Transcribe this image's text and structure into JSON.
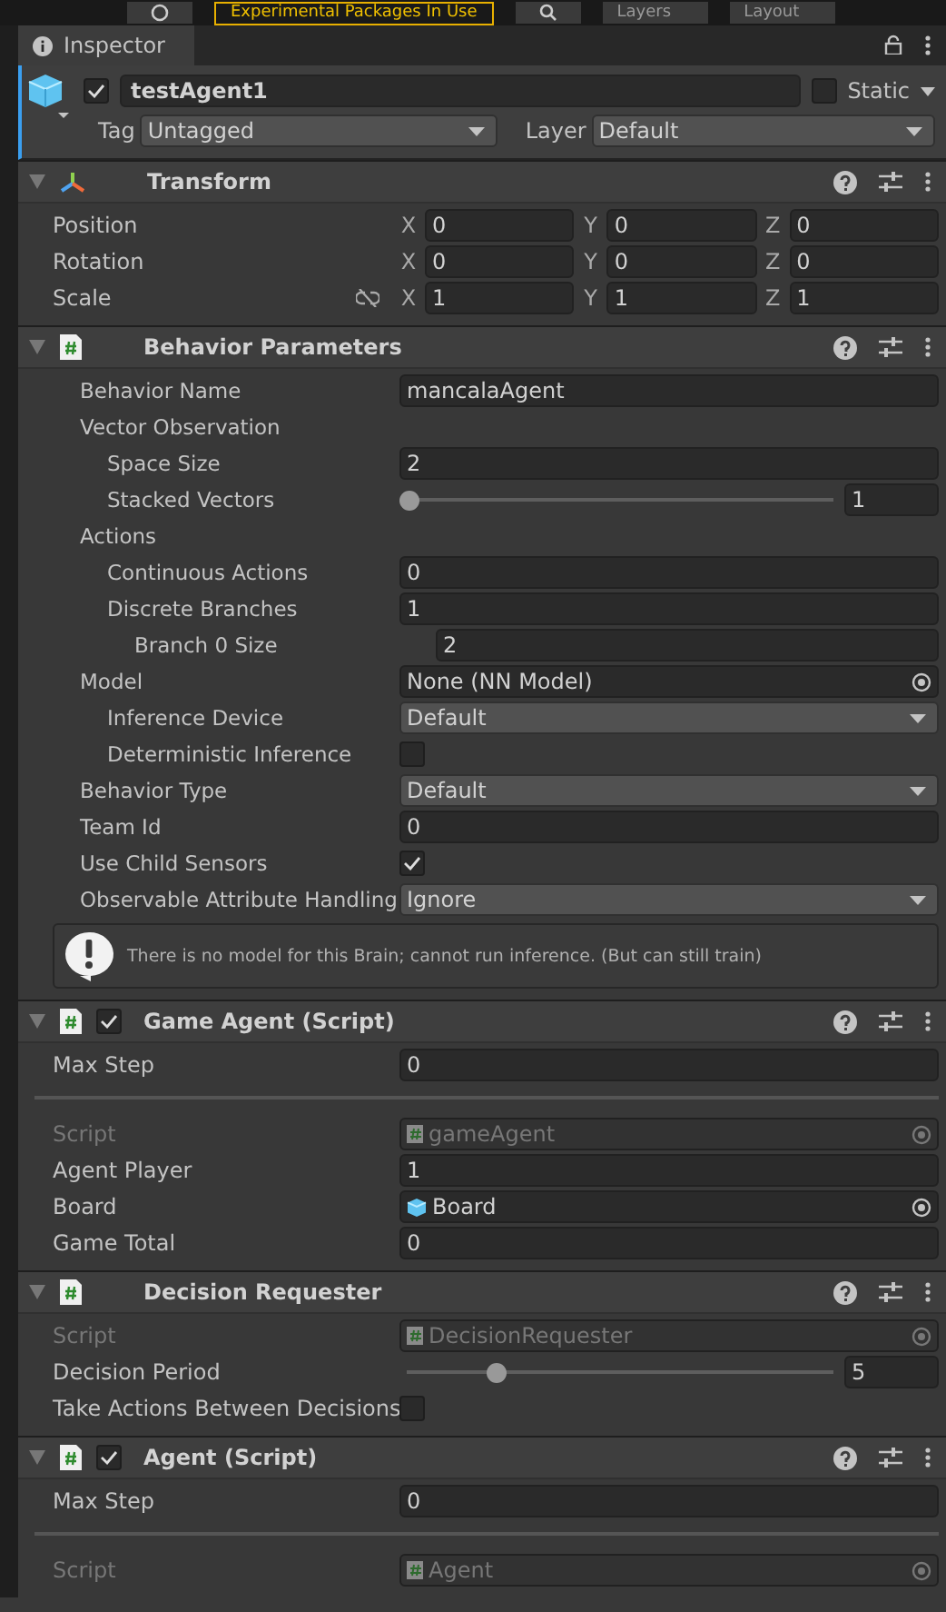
{
  "toolbar": {
    "packages_label": "Experimental Packages In Use",
    "layers_label": "Layers",
    "layout_label": "Layout"
  },
  "tab": {
    "title": "Inspector",
    "selected": true
  },
  "game_object": {
    "active": true,
    "name": "testAgent1",
    "static": false,
    "static_label": "Static",
    "tag_label": "Tag",
    "tag": "Untagged",
    "layer_label": "Layer",
    "layer": "Default"
  },
  "components": [
    {
      "title": "Transform",
      "kind": "transform",
      "expanded": true,
      "rows": [
        {
          "kind": "vector",
          "label": "Position",
          "link_icon": false,
          "axes": [
            {
              "axis": "X",
              "value": "0"
            },
            {
              "axis": "Y",
              "value": "0"
            },
            {
              "axis": "Z",
              "value": "0"
            }
          ]
        },
        {
          "kind": "vector",
          "label": "Rotation",
          "link_icon": false,
          "axes": [
            {
              "axis": "X",
              "value": "0"
            },
            {
              "axis": "Y",
              "value": "0"
            },
            {
              "axis": "Z",
              "value": "0"
            }
          ]
        },
        {
          "kind": "vector",
          "label": "Scale",
          "link_icon": true,
          "axes": [
            {
              "axis": "X",
              "value": "1"
            },
            {
              "axis": "Y",
              "value": "1"
            },
            {
              "axis": "Z",
              "value": "1"
            }
          ]
        }
      ]
    },
    {
      "title": "Behavior Parameters",
      "kind": "script",
      "expanded": true,
      "rows": [
        {
          "kind": "field",
          "label": "Behavior Name",
          "value": "mancalaAgent"
        },
        {
          "kind": "group",
          "label": "Vector Observation",
          "children": [
            {
              "kind": "field",
              "label": "Space Size",
              "value": "2"
            },
            {
              "kind": "slider",
              "label": "Stacked Vectors",
              "level": 0,
              "value": "1"
            }
          ]
        },
        {
          "kind": "group",
          "label": "Actions",
          "children": [
            {
              "kind": "field",
              "label": "Continuous Actions",
              "value": "0"
            },
            {
              "kind": "field",
              "label": "Discrete Branches",
              "value": "1",
              "children": [
                {
                  "kind": "field",
                  "label": "Branch 0 Size",
                  "value": "2"
                }
              ]
            }
          ]
        },
        {
          "kind": "object",
          "label": "Model",
          "value": "None (NN Model)",
          "disabled": false,
          "children": [
            {
              "kind": "dropdown",
              "label": "Inference Device",
              "value": "Default"
            },
            {
              "kind": "checkbox",
              "label": "Deterministic Inference",
              "checked": false
            }
          ]
        },
        {
          "kind": "dropdown",
          "label": "Behavior Type",
          "value": "Default"
        },
        {
          "kind": "field",
          "label": "Team Id",
          "value": "0"
        },
        {
          "kind": "checkbox",
          "label": "Use Child Sensors",
          "checked": true
        },
        {
          "kind": "dropdown",
          "label": "Observable Attribute Handling",
          "value": "Ignore"
        },
        {
          "kind": "helpbox",
          "text": "There is no model for this Brain; cannot run inference. (But can still train)"
        }
      ]
    },
    {
      "title": "Game Agent (Script)",
      "kind": "script",
      "enabled": true,
      "expanded": true,
      "rows": [
        {
          "kind": "field",
          "label": "Max Step",
          "value": "0"
        },
        {
          "kind": "divider"
        },
        {
          "kind": "script_object",
          "label": "Script",
          "value": "gameAgent",
          "disabled": true
        },
        {
          "kind": "field",
          "label": "Agent Player",
          "value": "1"
        },
        {
          "kind": "scene_object",
          "label": "Board",
          "value": "Board",
          "disabled": false
        },
        {
          "kind": "field",
          "label": "Game Total",
          "value": "0"
        }
      ]
    },
    {
      "title": "Decision Requester",
      "kind": "script",
      "expanded": true,
      "rows": [
        {
          "kind": "script_object",
          "label": "Script",
          "value": "DecisionRequester",
          "disabled": true
        },
        {
          "kind": "slider",
          "label": "Decision Period",
          "level": 0.21,
          "value": "5"
        },
        {
          "kind": "checkbox",
          "label": "Take Actions Between Decisions",
          "checked": false
        }
      ]
    },
    {
      "title": "Agent (Script)",
      "kind": "script",
      "enabled": true,
      "expanded": true,
      "rows": [
        {
          "kind": "field",
          "label": "Max Step",
          "value": "0"
        },
        {
          "kind": "divider"
        },
        {
          "kind": "script_object",
          "label": "Script",
          "value": "Agent",
          "disabled": true
        }
      ]
    }
  ]
}
